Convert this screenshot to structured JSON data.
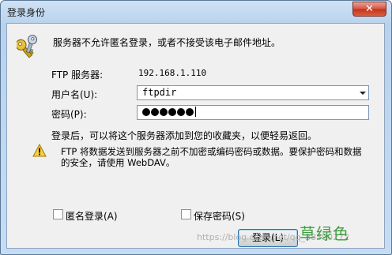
{
  "window": {
    "title": "登录身份",
    "close_glyph": "✕"
  },
  "intro_text": "服务器不允许匿名登录，或者不接受该电子邮件地址。",
  "ftp_server": {
    "label": "FTP 服务器:",
    "value": "192.168.1.110"
  },
  "username": {
    "label": "用户名(U):",
    "value": "ftpdir"
  },
  "password": {
    "label": "密码(P):",
    "masked_count": 6
  },
  "note_text": "登录后，可以将这个服务器添加到您的收藏夹，以便轻易返回。",
  "warning": {
    "line1": "FTP 将数据发送到服务器之前不加密或编码密码或数据。要保护密码和数据",
    "line2": "的安全，请使用 WebDAV。"
  },
  "anonymous_checkbox": {
    "label": "匿名登录(A)",
    "checked": false
  },
  "save_password_checkbox": {
    "label": "保存密码(S)",
    "checked": false
  },
  "login_button": {
    "label": "登录(L)"
  },
  "watermarks": {
    "url_text": "https://blog.csdn.net/qq_38390272",
    "overlay": "草绿色"
  },
  "icons": {
    "key": "key-icon",
    "warning": "warning-icon",
    "dropdown": "chevron-down-icon"
  }
}
